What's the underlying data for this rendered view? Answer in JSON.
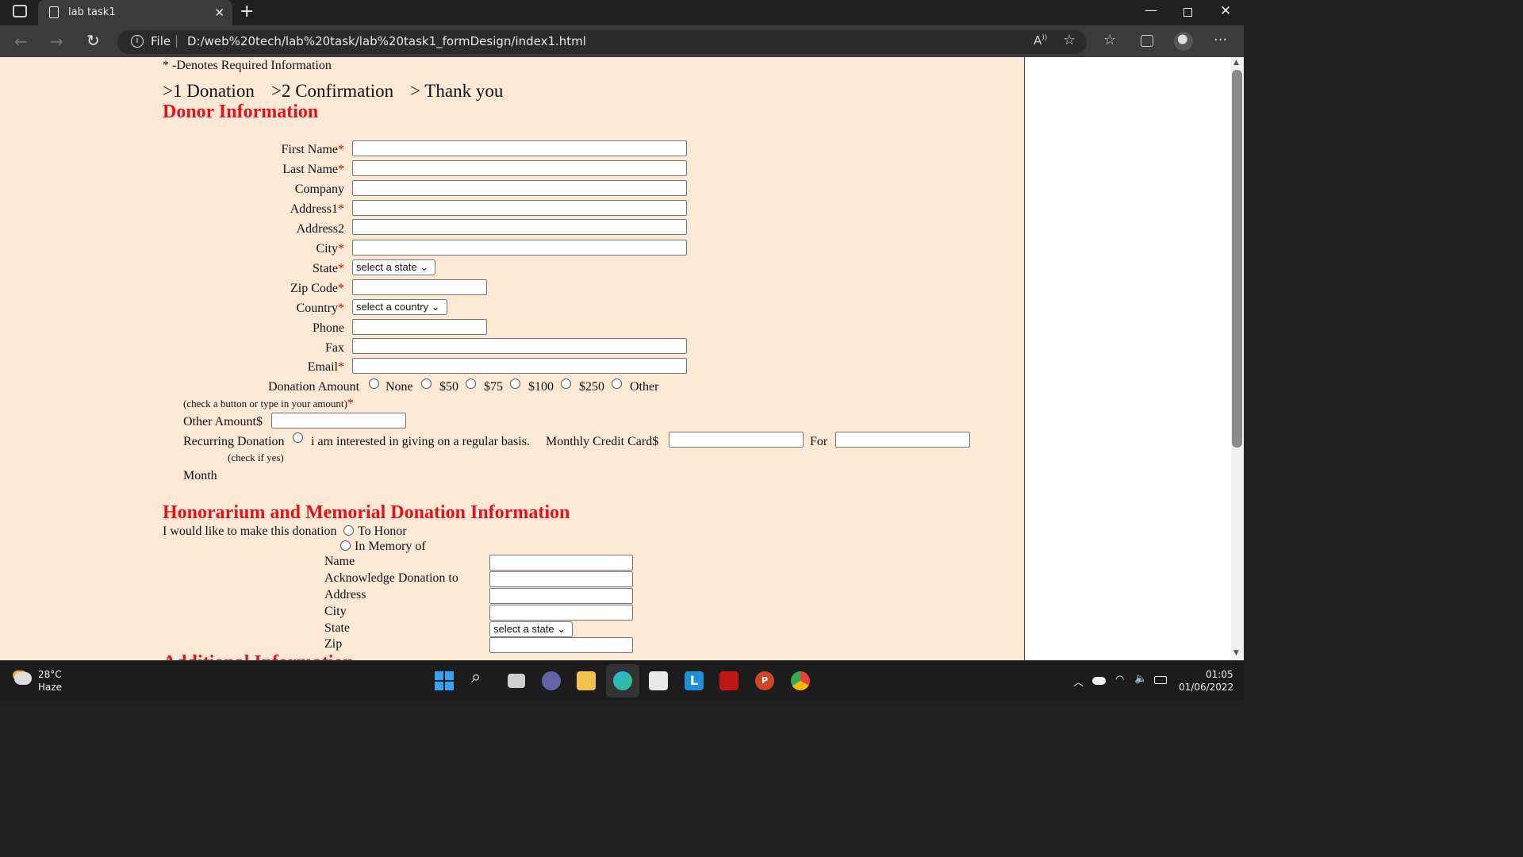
{
  "browser": {
    "tab_title": "lab task1",
    "url_scheme": "File",
    "url": "D:/web%20tech/lab%20task/lab%20task1_formDesign/index1.html"
  },
  "page": {
    "required_note": "* -Denotes Required Information",
    "steps": [
      ">1 Donation",
      ">2 Confirmation",
      "> Thank you"
    ],
    "donor_heading": "Donor Information",
    "fields": {
      "first_name": "First Name",
      "last_name": "Last Name",
      "company": "Company",
      "address1": "Address1",
      "address2": "Address2",
      "city": "City",
      "state": "State",
      "zip": "Zip Code",
      "country": "Country",
      "phone": "Phone",
      "fax": "Fax",
      "email": "Email"
    },
    "star": "*",
    "state_select": "select a state",
    "country_select": "select a country",
    "donation_amount_label": "Donation Amount",
    "donation_options": [
      "None",
      "$50",
      "$75",
      "$100",
      "$250",
      "Other"
    ],
    "donation_hint": "(check a button or type in your amount)",
    "other_amount_label": "Other Amount$",
    "recurring_label": "Recurring Donation",
    "recurring_hint": "(check if yes)",
    "recurring_text": "i am interested in giving on a regular basis.",
    "monthly_cc_label": "Monthly Credit Card$",
    "for_label": "For",
    "month_label": "Month",
    "honorarium_heading": "Honorarium and Memorial Donation Information",
    "make_donation_label": "I would like to make this donation",
    "to_honor": "To Honor",
    "in_memory": "In Memory of",
    "hon_fields": {
      "name": "Name",
      "ack": "Acknowledge Donation to",
      "address": "Address",
      "city": "City",
      "state": "State",
      "zip": "Zip"
    },
    "next_heading_partial": "Additional Information"
  },
  "taskbar": {
    "weather_temp": "28°C",
    "weather_desc": "Haze",
    "time": "01:05",
    "date": "01/06/2022"
  }
}
